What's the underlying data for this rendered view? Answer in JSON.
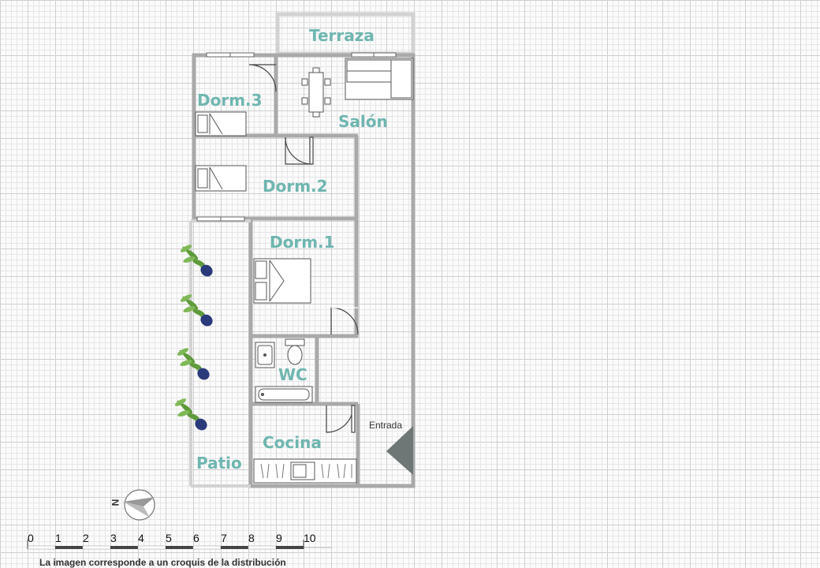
{
  "rooms": {
    "terraza": "Terraza",
    "dorm3": "Dorm.3",
    "salon": "Salón",
    "dorm2": "Dorm.2",
    "dorm1": "Dorm.1",
    "wc": "WC",
    "cocina": "Cocina",
    "patio": "Patio"
  },
  "entrance_label": "Entrada",
  "north_label": "N",
  "scale": {
    "ticks": [
      "0",
      "1",
      "2",
      "3",
      "4",
      "5",
      "6",
      "7",
      "8",
      "9",
      "10"
    ]
  },
  "caption": "La imagen corresponde a un croquis de la distribución",
  "colors": {
    "wall": "#a9a9a9",
    "label": "#6fb6b0",
    "grid": "#cfcfcf",
    "entrance_arrow": "#6f7676",
    "plant_pot": "#2b3a7a",
    "plant_leaf": "#6ea646"
  },
  "icons": [
    "door-icon",
    "window-icon",
    "bed-icon",
    "sofa-icon",
    "dining-table-icon",
    "sink-icon",
    "toilet-icon",
    "bathtub-icon",
    "kitchen-counter-icon",
    "plant-icon",
    "compass-icon",
    "entrance-arrow-icon"
  ]
}
